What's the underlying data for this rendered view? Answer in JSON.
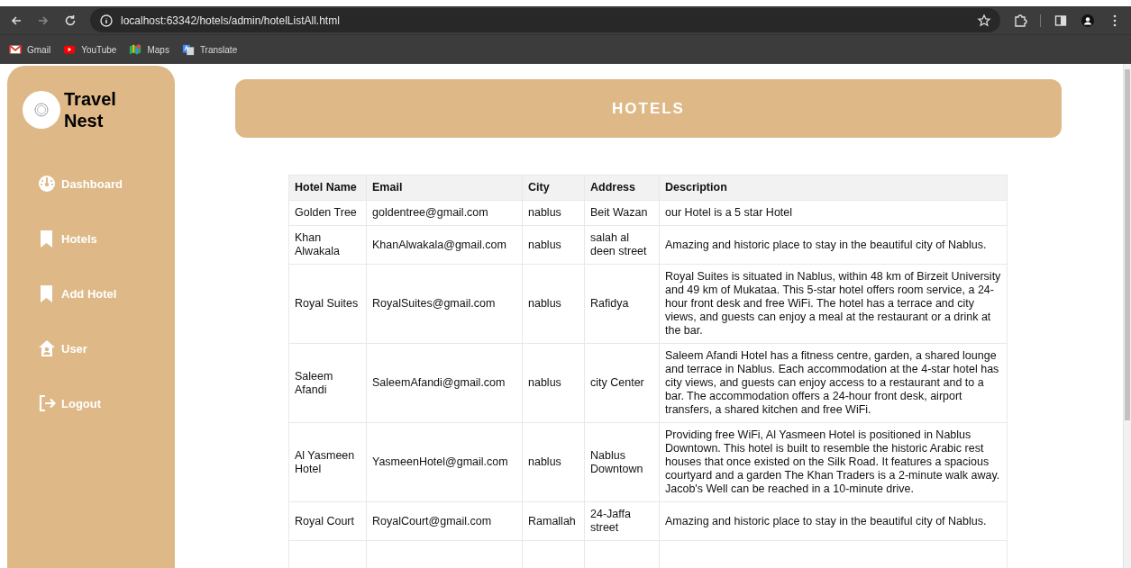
{
  "browser": {
    "url": "localhost:63342/hotels/admin/hotelListAll.html",
    "bookmarks": [
      {
        "label": "Gmail",
        "kind": "mail"
      },
      {
        "label": "YouTube",
        "kind": "video"
      },
      {
        "label": "Maps",
        "kind": "map"
      },
      {
        "label": "Translate",
        "kind": "translate"
      }
    ]
  },
  "sidebar": {
    "brand": "Travel Nest",
    "items": [
      {
        "label": "Dashboard",
        "kind": "dashboard"
      },
      {
        "label": "Hotels",
        "kind": "bookmark"
      },
      {
        "label": "Add Hotel",
        "kind": "bookmark"
      },
      {
        "label": "User",
        "kind": "user"
      },
      {
        "label": "Logout",
        "kind": "logout"
      }
    ]
  },
  "header": {
    "title": "HOTELS"
  },
  "table": {
    "columns": [
      "Hotel Name",
      "Email",
      "City",
      "Address",
      "Description"
    ],
    "rows": [
      [
        "Golden Tree",
        "goldentree@gmail.com",
        "nablus",
        "Beit Wazan",
        "our Hotel is a 5 star Hotel"
      ],
      [
        "Khan Alwakala",
        "KhanAlwakala@gmail.com",
        "nablus",
        "salah al deen street",
        "Amazing and historic place to stay in the beautiful city of Nablus."
      ],
      [
        "Royal Suites",
        "RoyalSuites@gmail.com",
        "nablus",
        "Rafidya",
        "Royal Suites is situated in Nablus, within 48 km of Birzeit University and 49 km of Mukataa. This 5-star hotel offers room service, a 24-hour front desk and free WiFi. The hotel has a terrace and city views, and guests can enjoy a meal at the restaurant or a drink at the bar."
      ],
      [
        "Saleem Afandi",
        "SaleemAfandi@gmail.com",
        "nablus",
        "city Center",
        "Saleem Afandi Hotel has a fitness centre, garden, a shared lounge and terrace in Nablus. Each accommodation at the 4-star hotel has city views, and guests can enjoy access to a restaurant and to a bar. The accommodation offers a 24-hour front desk, airport transfers, a shared kitchen and free WiFi."
      ],
      [
        "Al Yasmeen Hotel",
        "YasmeenHotel@gmail.com",
        "nablus",
        "Nablus Downtown",
        "Providing free WiFi, Al Yasmeen Hotel is positioned in Nablus Downtown. This hotel is built to resemble the historic Arabic rest houses that once existed on the Silk Road. It features a spacious courtyard and a garden The Khan Traders is a 2-minute walk away. Jacob's Well can be reached in a 10-minute drive."
      ],
      [
        "Royal Court",
        "RoyalCourt@gmail.com",
        "Ramallah",
        "24-Jaffa street",
        "Amazing and historic place to stay in the beautiful city of Nablus."
      ]
    ]
  }
}
